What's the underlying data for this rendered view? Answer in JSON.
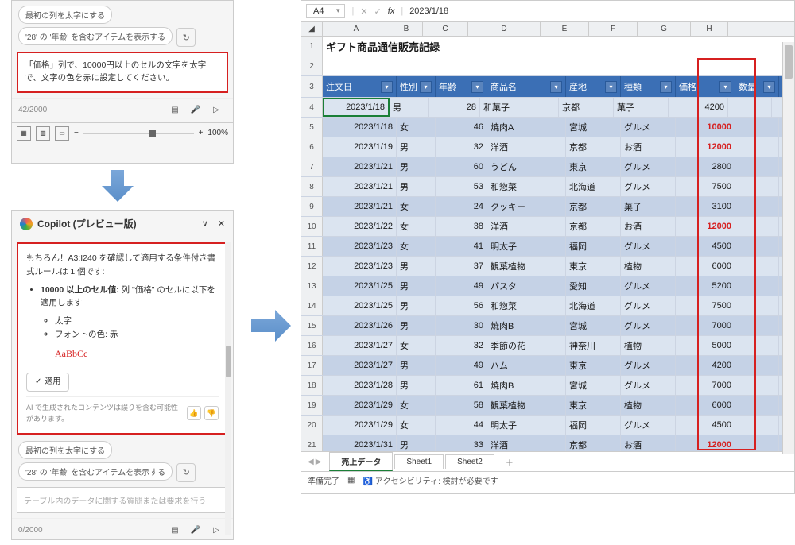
{
  "panel1": {
    "chip1": "最初の列を太字にする",
    "chip2": "'28' の '年齢' を含むアイテムを表示する",
    "input": "「価格」列で、10000円以上のセルの文字を太字で、文字の色を赤に設定してください。",
    "counter": "42/2000",
    "zoom": "100%"
  },
  "panel2": {
    "title": "Copilot (プレビュー版)",
    "msg_intro": "もちろん！A3:I240 を確認して適用する条件付き書式ルールは 1 個です:",
    "rule_title": "10000 以上のセル値:",
    "rule_target": "列 \"価格\" のセルに以下を適用します",
    "rule1": "太字",
    "rule2": "フォントの色: 赤",
    "sample": "AaBbCc",
    "apply": "適用",
    "disclaimer": "AI で生成されたコンテンツは誤りを含む可能性があります。",
    "chip1": "最初の列を太字にする",
    "chip2": "'28' の '年齢' を含むアイテムを表示する",
    "placeholder": "テーブル内のデータに関する質問または要求を行う",
    "counter": "0/2000"
  },
  "excel": {
    "cellref": "A4",
    "formula": "2023/1/18",
    "title": "ギフト商品通信販売記録",
    "headers": [
      "注文日",
      "性別",
      "年齢",
      "商品名",
      "産地",
      "種類",
      "価格",
      "数量"
    ],
    "cols": [
      "A",
      "B",
      "C",
      "D",
      "E",
      "F",
      "G",
      "H"
    ],
    "tabs": {
      "active": "売上データ",
      "t2": "Sheet1",
      "t3": "Sheet2"
    },
    "status": {
      "ready": "準備完了",
      "access": "アクセシビリティ: 検討が必要です"
    },
    "rows": [
      {
        "n": 4,
        "d": "2023/1/18",
        "s": "男",
        "a": 28,
        "p": "和菓子",
        "o": "京都",
        "k": "菓子",
        "pr": 4200,
        "red": false
      },
      {
        "n": 5,
        "d": "2023/1/18",
        "s": "女",
        "a": 46,
        "p": "焼肉A",
        "o": "宮城",
        "k": "グルメ",
        "pr": 10000,
        "red": true
      },
      {
        "n": 6,
        "d": "2023/1/19",
        "s": "男",
        "a": 32,
        "p": "洋酒",
        "o": "京都",
        "k": "お酒",
        "pr": 12000,
        "red": true
      },
      {
        "n": 7,
        "d": "2023/1/21",
        "s": "男",
        "a": 60,
        "p": "うどん",
        "o": "東京",
        "k": "グルメ",
        "pr": 2800,
        "red": false
      },
      {
        "n": 8,
        "d": "2023/1/21",
        "s": "男",
        "a": 53,
        "p": "和惣菜",
        "o": "北海道",
        "k": "グルメ",
        "pr": 7500,
        "red": false
      },
      {
        "n": 9,
        "d": "2023/1/21",
        "s": "女",
        "a": 24,
        "p": "クッキー",
        "o": "京都",
        "k": "菓子",
        "pr": 3100,
        "red": false
      },
      {
        "n": 10,
        "d": "2023/1/22",
        "s": "女",
        "a": 38,
        "p": "洋酒",
        "o": "京都",
        "k": "お酒",
        "pr": 12000,
        "red": true
      },
      {
        "n": 11,
        "d": "2023/1/23",
        "s": "女",
        "a": 41,
        "p": "明太子",
        "o": "福岡",
        "k": "グルメ",
        "pr": 4500,
        "red": false
      },
      {
        "n": 12,
        "d": "2023/1/23",
        "s": "男",
        "a": 37,
        "p": "観葉植物",
        "o": "東京",
        "k": "植物",
        "pr": 6000,
        "red": false
      },
      {
        "n": 13,
        "d": "2023/1/25",
        "s": "男",
        "a": 49,
        "p": "パスタ",
        "o": "愛知",
        "k": "グルメ",
        "pr": 5200,
        "red": false
      },
      {
        "n": 14,
        "d": "2023/1/25",
        "s": "男",
        "a": 56,
        "p": "和惣菜",
        "o": "北海道",
        "k": "グルメ",
        "pr": 7500,
        "red": false
      },
      {
        "n": 15,
        "d": "2023/1/26",
        "s": "男",
        "a": 30,
        "p": "焼肉B",
        "o": "宮城",
        "k": "グルメ",
        "pr": 7000,
        "red": false
      },
      {
        "n": 16,
        "d": "2023/1/27",
        "s": "女",
        "a": 32,
        "p": "季節の花",
        "o": "神奈川",
        "k": "植物",
        "pr": 5000,
        "red": false
      },
      {
        "n": 17,
        "d": "2023/1/27",
        "s": "男",
        "a": 49,
        "p": "ハム",
        "o": "東京",
        "k": "グルメ",
        "pr": 4200,
        "red": false
      },
      {
        "n": 18,
        "d": "2023/1/28",
        "s": "男",
        "a": 61,
        "p": "焼肉B",
        "o": "宮城",
        "k": "グルメ",
        "pr": 7000,
        "red": false
      },
      {
        "n": 19,
        "d": "2023/1/29",
        "s": "女",
        "a": 58,
        "p": "観葉植物",
        "o": "東京",
        "k": "植物",
        "pr": 6000,
        "red": false
      },
      {
        "n": 20,
        "d": "2023/1/29",
        "s": "女",
        "a": 44,
        "p": "明太子",
        "o": "福岡",
        "k": "グルメ",
        "pr": 4500,
        "red": false
      },
      {
        "n": 21,
        "d": "2023/1/31",
        "s": "男",
        "a": 33,
        "p": "洋酒",
        "o": "京都",
        "k": "お酒",
        "pr": 12000,
        "red": true
      }
    ]
  }
}
